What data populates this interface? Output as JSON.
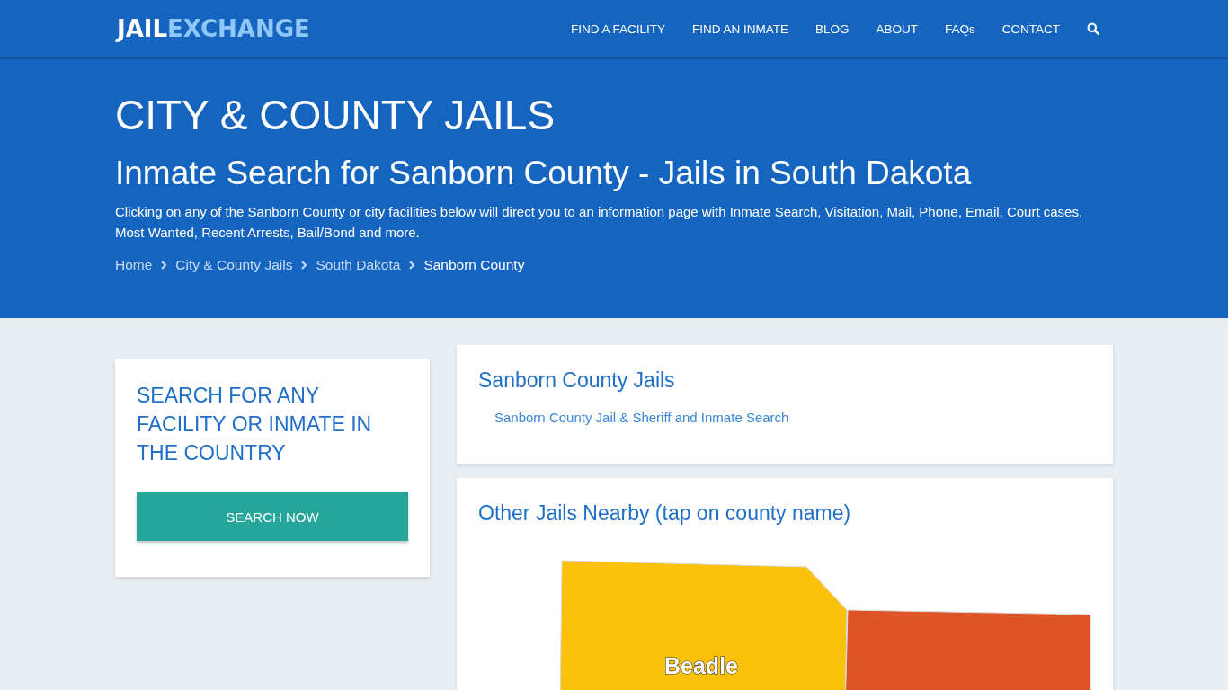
{
  "logo": {
    "part_1": "JAIL",
    "part_2": "EXCHANGE"
  },
  "nav": [
    "FIND A FACILITY",
    "FIND AN INMATE",
    "BLOG",
    "ABOUT",
    "FAQs",
    "CONTACT"
  ],
  "hero": {
    "title": "CITY & COUNTY JAILS",
    "subtitle": "Inmate Search for Sanborn County - Jails in South Dakota",
    "description": "Clicking on any of the Sanborn County or city facilities below will direct you to an information page with Inmate Search, Visitation, Mail, Phone, Email, Court cases, Most Wanted, Recent Arrests, Bail/Bond and more.",
    "breadcrumbs": [
      {
        "label": "Home",
        "current": false
      },
      {
        "label": "City & County Jails",
        "current": false
      },
      {
        "label": "South Dakota",
        "current": false
      },
      {
        "label": "Sanborn County",
        "current": true
      }
    ]
  },
  "search_card": {
    "heading": "SEARCH FOR ANY FACILITY OR INMATE IN THE COUNTRY",
    "button": "SEARCH NOW"
  },
  "jails_card": {
    "heading": "Sanborn County Jails",
    "links": [
      "Sanborn County Jail & Sheriff and Inmate Search"
    ]
  },
  "nearby_card": {
    "heading": "Other Jails Nearby (tap on county name)",
    "counties": [
      {
        "name": "Beadle",
        "color": "#fcc10a"
      },
      {
        "color": "#df5426"
      }
    ]
  }
}
